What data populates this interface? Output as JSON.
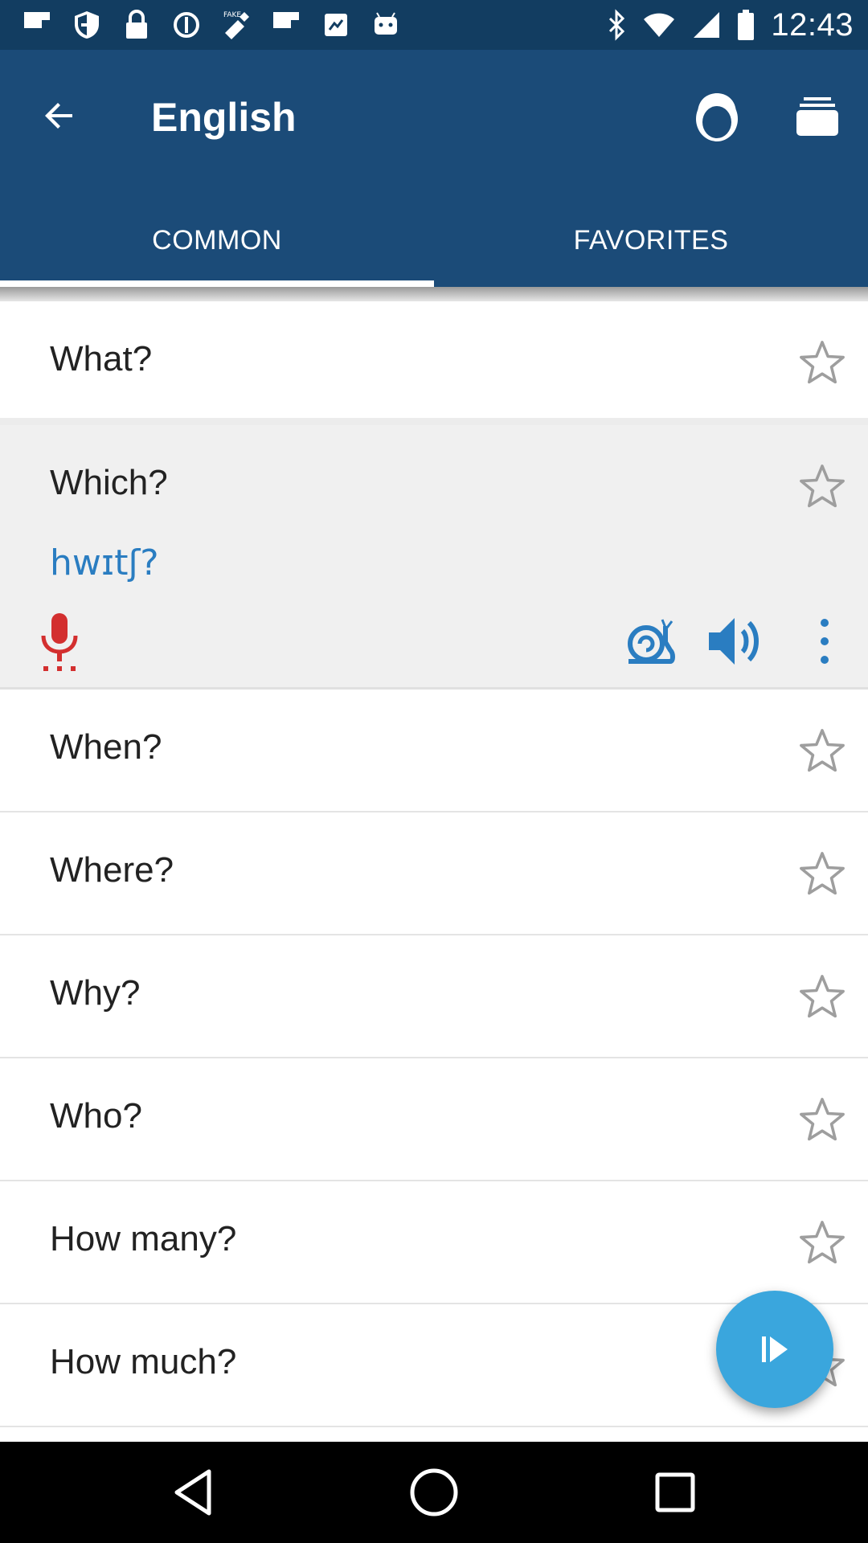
{
  "status_bar": {
    "time": "12:43",
    "left_icons": [
      "flipboard-icon",
      "shield-icon",
      "lock-icon",
      "sync-icon",
      "fake-gps-icon",
      "flipboard-icon",
      "flag-icon",
      "android-icon"
    ],
    "right_icons": [
      "bluetooth-icon",
      "wifi-icon",
      "signal-icon",
      "battery-icon"
    ]
  },
  "app_bar": {
    "title": "English",
    "tabs": [
      {
        "label": "COMMON",
        "selected": true
      },
      {
        "label": "FAVORITES",
        "selected": false
      }
    ]
  },
  "phrases": [
    {
      "text": "What?"
    },
    {
      "text": "Which?",
      "phonetic": "hwɪtʃ?"
    },
    {
      "text": "When?"
    },
    {
      "text": "Where?"
    },
    {
      "text": "Why?"
    },
    {
      "text": "Who?"
    },
    {
      "text": "How many?"
    },
    {
      "text": "How much?"
    }
  ],
  "colors": {
    "status_bar": "#123d61",
    "app_bar": "#1b4b78",
    "accent_blue": "#2a7dc1",
    "fab": "#3aa6dd",
    "mic_red": "#d32f2f"
  }
}
